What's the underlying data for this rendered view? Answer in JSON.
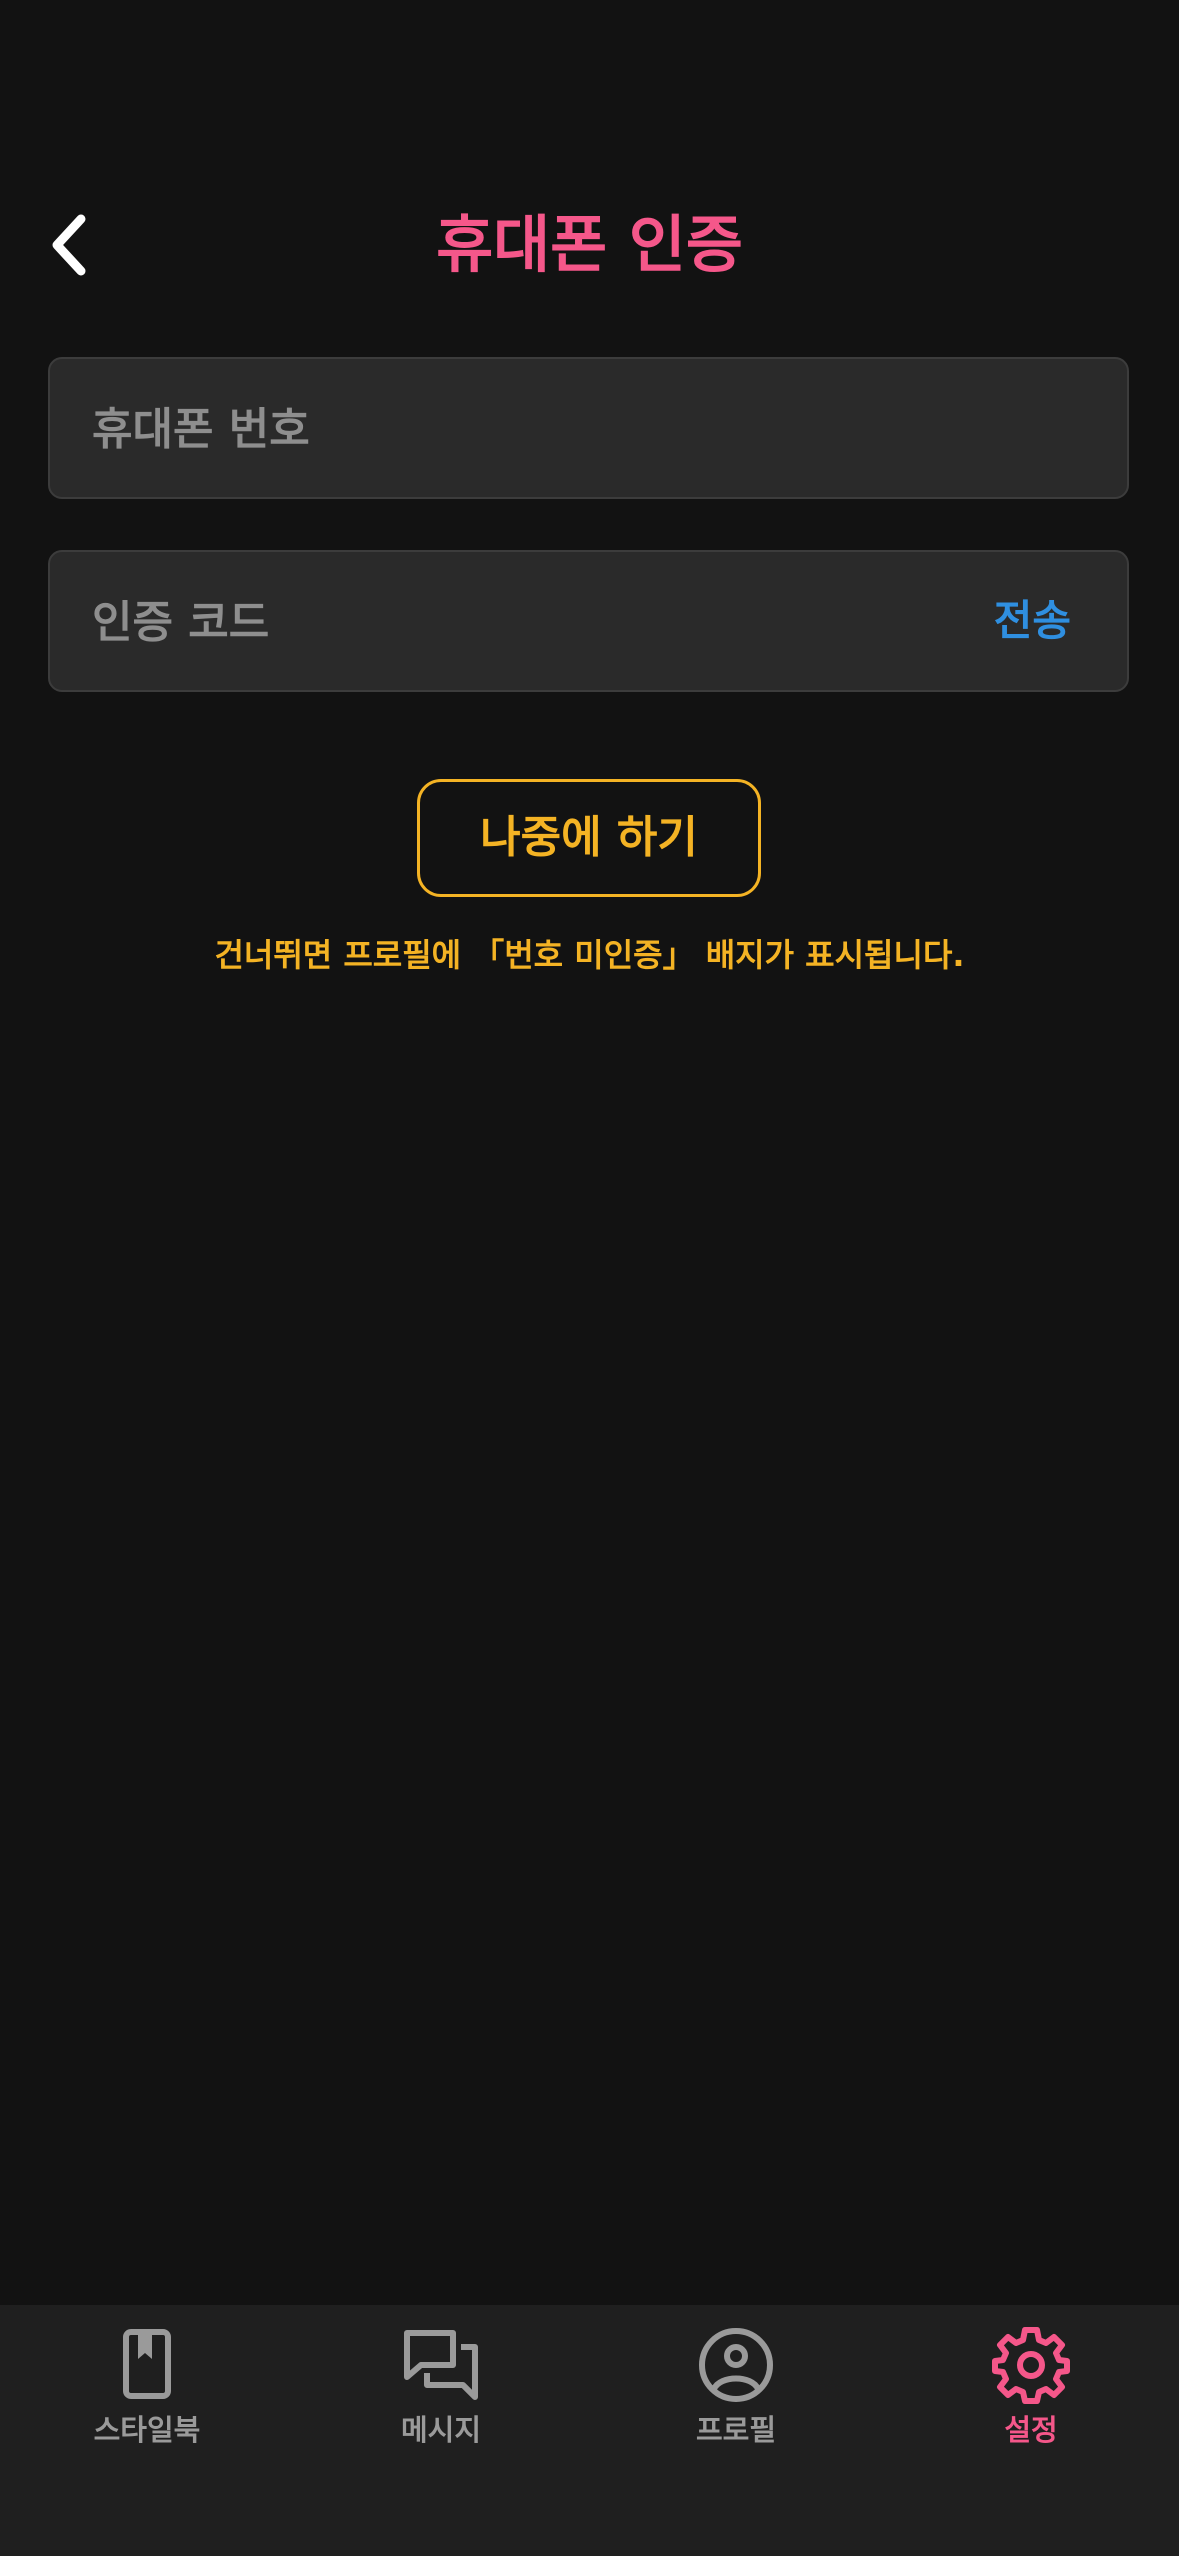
{
  "header": {
    "title": "휴대폰 인증",
    "back_icon": "chevron-left-icon"
  },
  "form": {
    "phone_placeholder": "휴대폰 번호",
    "phone_value": "",
    "code_placeholder": "인증 코드",
    "code_value": "",
    "send_label": "전송"
  },
  "later_button_label": "나중에 하기",
  "skip_notice": "건너뛰면 프로필에 「번호 미인증」 배지가 표시됩니다.",
  "tabs": [
    {
      "label": "스타일북",
      "icon": "bookmark-book-icon",
      "active": false
    },
    {
      "label": "메시지",
      "icon": "chat-bubbles-icon",
      "active": false
    },
    {
      "label": "프로필",
      "icon": "user-circle-icon",
      "active": false
    },
    {
      "label": "설정",
      "icon": "gear-icon",
      "active": true
    }
  ],
  "colors": {
    "accent_pink": "#f5578a",
    "warning_amber": "#f4b324",
    "link_blue": "#2f8fe0",
    "background": "#121212",
    "field_bg": "#2a2a2a",
    "tabbar_bg": "#1f1f1f",
    "inactive_tab": "#9a9a9a"
  }
}
